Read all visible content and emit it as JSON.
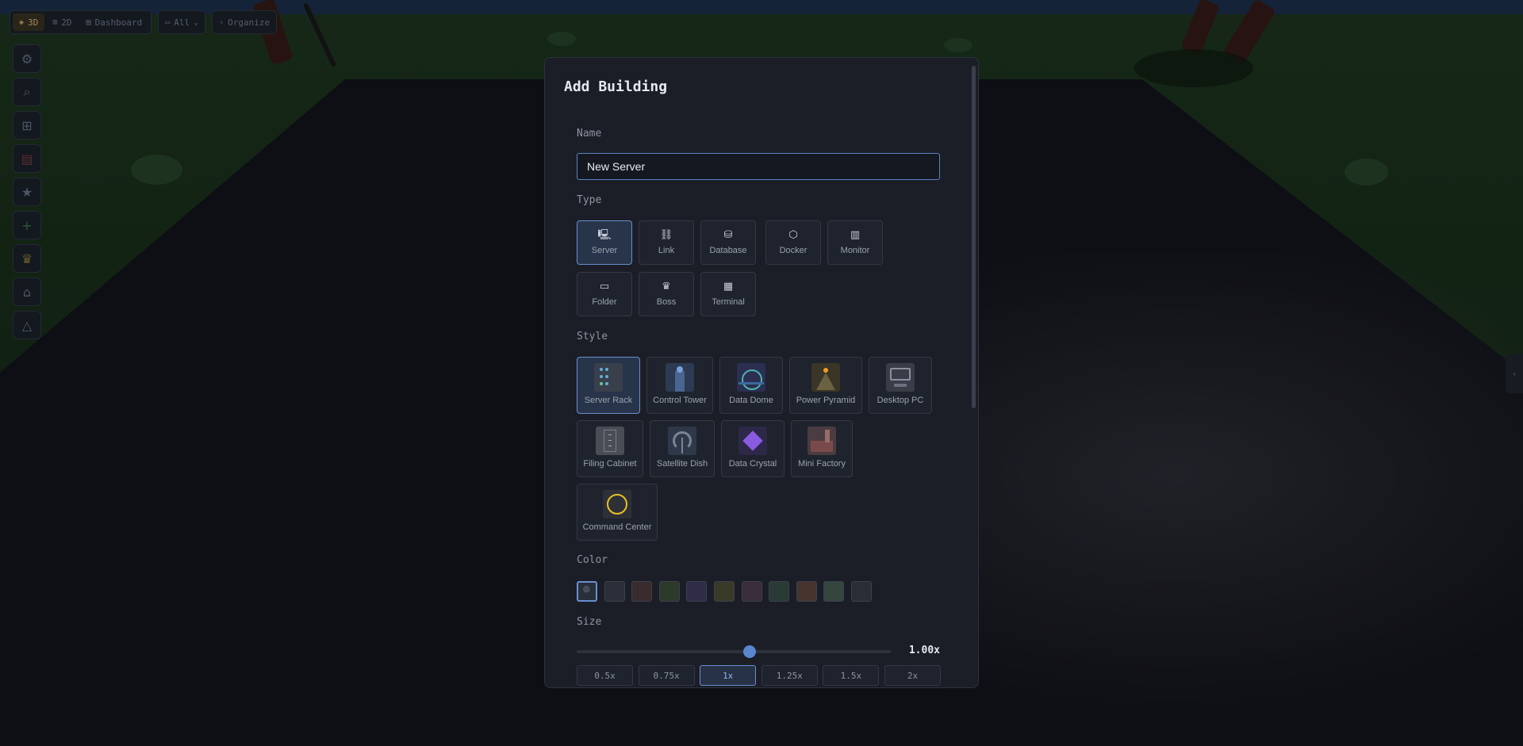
{
  "topbar": {
    "views": [
      {
        "label": "3D",
        "icon": "layers-icon",
        "active": true
      },
      {
        "label": "2D",
        "icon": "grid-icon",
        "active": false
      },
      {
        "label": "Dashboard",
        "icon": "dashboard-icon",
        "active": false
      }
    ],
    "filter_label": "All",
    "organize_label": "Organize"
  },
  "sidebar": {
    "items": [
      {
        "name": "settings",
        "icon": "gear-icon"
      },
      {
        "name": "search",
        "icon": "search-icon"
      },
      {
        "name": "apps",
        "icon": "apps-grid-icon"
      },
      {
        "name": "list",
        "icon": "list-icon"
      },
      {
        "name": "favorites",
        "icon": "star-icon"
      },
      {
        "name": "add",
        "icon": "plus-icon"
      },
      {
        "name": "boss",
        "icon": "crown-icon"
      },
      {
        "name": "buildings",
        "icon": "building-icon"
      },
      {
        "name": "alerts",
        "icon": "triangle-icon"
      }
    ]
  },
  "modal": {
    "title": "Add Building",
    "name_label": "Name",
    "name_value": "New Server",
    "type_label": "Type",
    "types": [
      {
        "label": "Server",
        "icon": "server-icon",
        "selected": true
      },
      {
        "label": "Link",
        "icon": "link-icon",
        "selected": false
      },
      {
        "label": "Database",
        "icon": "database-icon",
        "selected": false
      },
      {
        "label": "Docker",
        "icon": "cube-icon",
        "selected": false
      },
      {
        "label": "Monitor",
        "icon": "bar-chart-icon",
        "selected": false
      },
      {
        "label": "Folder",
        "icon": "folder-icon",
        "selected": false
      },
      {
        "label": "Boss",
        "icon": "crown-icon",
        "selected": false
      },
      {
        "label": "Terminal",
        "icon": "terminal-icon",
        "selected": false
      }
    ],
    "style_label": "Style",
    "styles": [
      {
        "label": "Server Rack",
        "selected": true
      },
      {
        "label": "Control Tower",
        "selected": false
      },
      {
        "label": "Data Dome",
        "selected": false
      },
      {
        "label": "Power Pyramid",
        "selected": false
      },
      {
        "label": "Desktop PC",
        "selected": false
      },
      {
        "label": "Filing Cabinet",
        "selected": false
      },
      {
        "label": "Satellite Dish",
        "selected": false
      },
      {
        "label": "Data Crystal",
        "selected": false
      },
      {
        "label": "Mini Factory",
        "selected": false
      },
      {
        "label": "Command Center",
        "selected": false
      }
    ],
    "color_label": "Color",
    "colors": [
      "#2a2f3c",
      "#2c2e3a",
      "#3a2c2c",
      "#2c3a2c",
      "#302c48",
      "#3a3a28",
      "#3a2c3a",
      "#2a3a34",
      "#48342e",
      "#34463e",
      "#2a2d36"
    ],
    "size_label": "Size",
    "size_value": 1.0,
    "size_value_text": "1.00x",
    "size_min": 0.5,
    "size_max": 2,
    "size_options": [
      "0.5x",
      "0.75x",
      "1x",
      "1.25x",
      "1.5x",
      "2x"
    ],
    "size_selected": "1x"
  }
}
